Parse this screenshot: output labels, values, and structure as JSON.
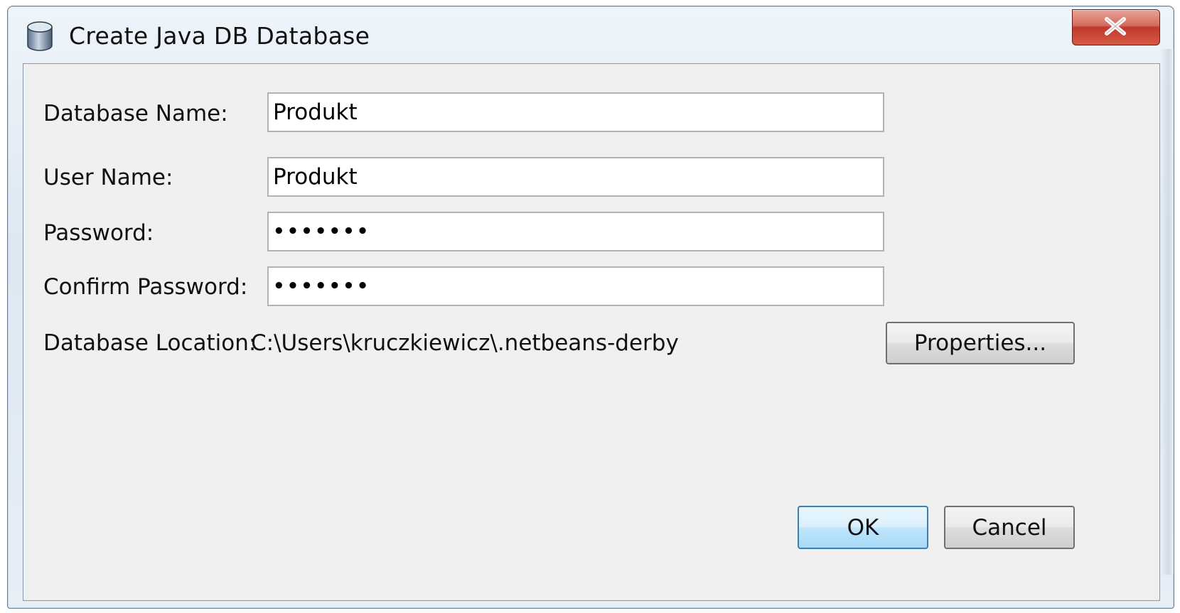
{
  "window": {
    "title": "Create Java DB Database"
  },
  "form": {
    "database_name_label": "Database Name:",
    "database_name_value": "Produkt",
    "user_name_label": "User Name:",
    "user_name_value": "Produkt",
    "password_label": "Password:",
    "password_value": "•••••••",
    "confirm_password_label": "Confirm Password:",
    "confirm_password_value": "•••••••",
    "database_location_label": "Database Location:",
    "database_location_value": "C:\\Users\\kruczkiewicz\\.netbeans-derby"
  },
  "buttons": {
    "properties_label": "Properties...",
    "ok_label": "OK",
    "cancel_label": "Cancel"
  },
  "icons": {
    "app": "database-cylinder-icon",
    "close": "close-x-icon"
  },
  "colors": {
    "dialog_bg": "#f0f0f0",
    "close_button": "#c0392b",
    "default_button": "#bee6fd"
  }
}
